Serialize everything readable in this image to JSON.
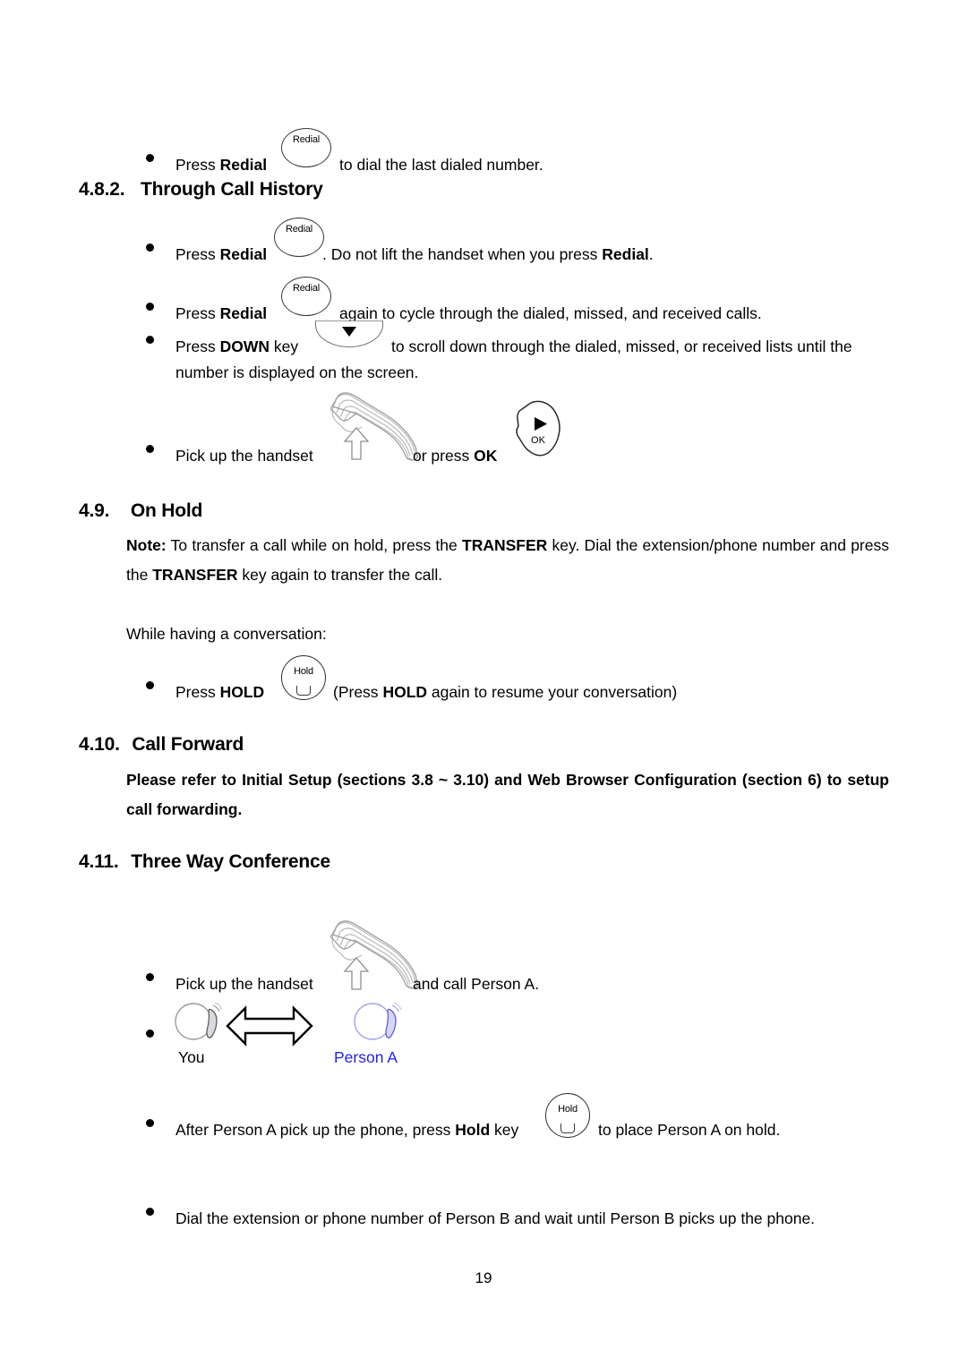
{
  "document": {
    "page_number": "19"
  },
  "sections": {
    "redial_intro": {
      "bullet_pre": "Press ",
      "bold": "Redial",
      "post": " to dial the last dialed number.",
      "key_label": "Redial"
    },
    "call_history": {
      "number": "4.8.2.",
      "title": "Through Call History",
      "items": [
        {
          "pre": "Press ",
          "bold1": "Redial",
          "mid": ". Do not lift the handset when you press ",
          "bold2": "Redial",
          "post": ".",
          "key_label": "Redial"
        },
        {
          "pre": "Press ",
          "bold1": "Redial",
          "post": " again to cycle through the dialed, missed, and received calls.",
          "key_label": "Redial"
        },
        {
          "pre": "Press ",
          "bold1": "DOWN",
          "mid": " key",
          "post": " to scroll down through the dialed, missed, or received lists until the",
          "line2": "number is displayed on the screen.",
          "key_label": "DOWN"
        },
        {
          "pre": "Pick up the handset",
          "mid": " or press ",
          "bold1": "OK",
          "key_label": "OK"
        }
      ]
    },
    "on_hold": {
      "number": "4.9.",
      "title": "On Hold",
      "note_label": "Note:",
      "note_text_1": " To transfer a call while on hold, press the ",
      "note_bold_1": "TRANSFER",
      "note_text_2": " key. Dial the extension/phone number and press the ",
      "note_bold_2": "TRANSFER",
      "note_text_3": " key again to transfer the call.",
      "intro": "While having a conversation:",
      "item": {
        "pre": "Press ",
        "bold1": "HOLD",
        "mid": " (Press ",
        "bold2": "HOLD",
        "post": " again to resume your conversation)",
        "key_label": "Hold"
      }
    },
    "call_forward": {
      "number": "4.10.",
      "title": "Call Forward",
      "body": "Please refer to Initial Setup (sections 3.8 ~ 3.10) and Web Browser Configuration (section 6) to setup call forwarding."
    },
    "three_way": {
      "number": "4.11.",
      "title": "Three Way Conference",
      "item_handset": {
        "pre": "Pick up the handset",
        "post": " and call Person A."
      },
      "diagram": {
        "you_label": "You",
        "person_a_label": "Person A",
        "person_a_color": "#2222ee"
      },
      "item_hold": {
        "pre": "After Person A pick up the phone, press ",
        "bold1": "Hold",
        "mid": " key",
        "post": " to place Person A on hold.",
        "key_label": "Hold"
      },
      "item_dial": {
        "text": "Dial the extension or phone number of Person B and wait until Person B picks up the phone."
      }
    }
  }
}
